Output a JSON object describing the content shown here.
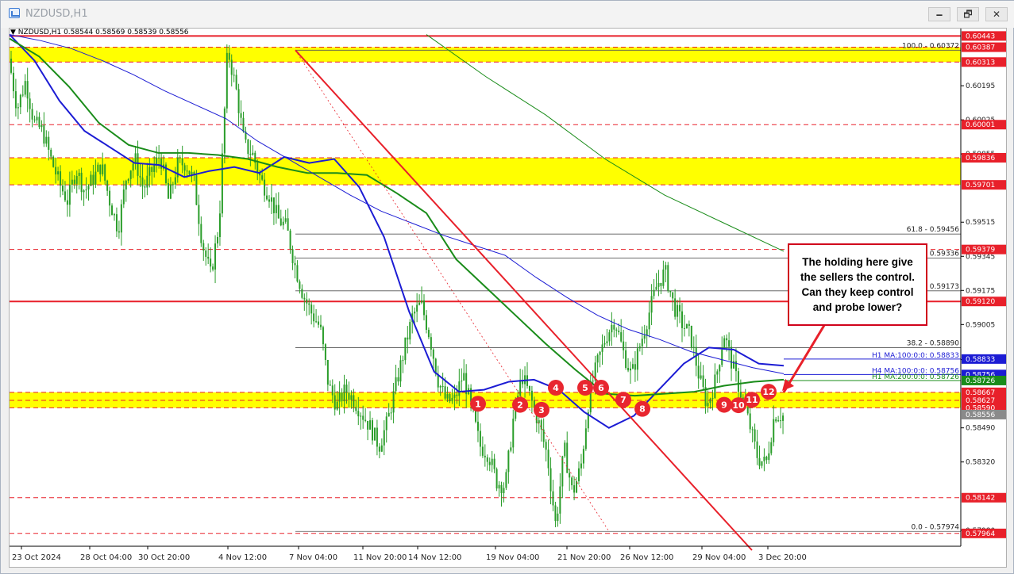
{
  "window": {
    "title": "NZDUSD,H1",
    "minimize_label": "🗕",
    "restore_label": "🗗",
    "close_label": "✕"
  },
  "symbol_line": "NZDUSD,H1  0.58544 0.58569 0.58539 0.58556",
  "callout_text": "The holding here give the sellers the control. Can they keep control and probe lower?",
  "colors": {
    "red": "#e8202a",
    "yellow": "#ffff00",
    "ma_blue": "#1c1cd4",
    "ma_green": "#1a8c1a",
    "candle": "#2a9d2a",
    "fib": "#555555",
    "marker": "#e8262f"
  },
  "chart_data": {
    "type": "candlestick",
    "symbol": "NZDUSD",
    "timeframe": "H1",
    "ohlc_last": {
      "open": 0.58544,
      "high": 0.58569,
      "low": 0.58539,
      "close": 0.58556
    },
    "ylim": [
      0.579,
      0.6048
    ],
    "x_ticks": [
      "23 Oct 2024",
      "28 Oct 04:00",
      "30 Oct 20:00",
      "4 Nov 12:00",
      "7 Nov 04:00",
      "11 Nov 20:00",
      "14 Nov 12:00",
      "19 Nov 04:00",
      "21 Nov 20:00",
      "26 Nov 12:00",
      "29 Nov 04:00",
      "3 Dec 20:00"
    ],
    "y_ticks": [
      "0.60195",
      "0.60025",
      "0.59855",
      "0.59515",
      "0.59345",
      "0.59175",
      "0.59005",
      "0.58830",
      "0.58490",
      "0.58320",
      "0.57980"
    ],
    "price_labels": [
      {
        "text": "0.60443",
        "value": 0.60443,
        "style": "red"
      },
      {
        "text": "0.60387",
        "value": 0.60387,
        "style": "red"
      },
      {
        "text": "0.60313",
        "value": 0.60313,
        "style": "red"
      },
      {
        "text": "0.60001",
        "value": 0.60001,
        "style": "red"
      },
      {
        "text": "0.59836",
        "value": 0.59836,
        "style": "red"
      },
      {
        "text": "0.59701",
        "value": 0.59701,
        "style": "red"
      },
      {
        "text": "0.59379",
        "value": 0.59379,
        "style": "red"
      },
      {
        "text": "0.59120",
        "value": 0.5912,
        "style": "red"
      },
      {
        "text": "0.58833",
        "value": 0.58833,
        "style": "blue"
      },
      {
        "text": "0.58756",
        "value": 0.58756,
        "style": "blue"
      },
      {
        "text": "0.58726",
        "value": 0.58726,
        "style": "green"
      },
      {
        "text": "0.58667",
        "value": 0.58667,
        "style": "red"
      },
      {
        "text": "0.58627",
        "value": 0.58627,
        "style": "red"
      },
      {
        "text": "0.58590",
        "value": 0.5859,
        "style": "red"
      },
      {
        "text": "0.58556",
        "value": 0.58556,
        "style": "gray"
      },
      {
        "text": "0.58142",
        "value": 0.58142,
        "style": "red"
      },
      {
        "text": "0.57964",
        "value": 0.57964,
        "style": "red"
      }
    ],
    "zones": [
      {
        "from": 0.60313,
        "to": 0.60387
      },
      {
        "from": 0.59701,
        "to": 0.59836
      },
      {
        "from": 0.5859,
        "to": 0.58667
      }
    ],
    "fib_levels": [
      {
        "label": "100.0 - 0.60372",
        "value": 0.60372
      },
      {
        "label": "61.8 - 0.59456",
        "value": 0.59456
      },
      {
        "label": "0.59336",
        "value": 0.59336
      },
      {
        "label": "0.59173",
        "value": 0.59173
      },
      {
        "label": "38.2 - 0.58890",
        "value": 0.5889
      },
      {
        "label": "0.0 - 0.57974",
        "value": 0.57974
      }
    ],
    "ma_labels": [
      {
        "text": "H1 MA:100:0:0: 0.58833",
        "value": 0.58833
      },
      {
        "text": "H4 MA:100:0:0: 0.58756",
        "value": 0.58756
      },
      {
        "text": "H1 MA:200:0:0: 0.58726",
        "value": 0.58726
      }
    ],
    "markers": [
      {
        "label": "1",
        "price": 0.5861
      },
      {
        "label": "2",
        "price": 0.58605
      },
      {
        "label": "3",
        "price": 0.5858
      },
      {
        "label": "4",
        "price": 0.5869
      },
      {
        "label": "5",
        "price": 0.5869
      },
      {
        "label": "6",
        "price": 0.5869
      },
      {
        "label": "7",
        "price": 0.5863
      },
      {
        "label": "8",
        "price": 0.58585
      },
      {
        "label": "9",
        "price": 0.58605
      },
      {
        "label": "10",
        "price": 0.58603
      },
      {
        "label": "11",
        "price": 0.5863
      },
      {
        "label": "12",
        "price": 0.5867
      }
    ],
    "series": [
      {
        "name": "H1 MA 100",
        "values": [
          0.6045,
          0.6032,
          0.6012,
          0.5997,
          0.5989,
          0.5981,
          0.598,
          0.5974,
          0.5977,
          0.5979,
          0.5976,
          0.5984,
          0.5981,
          0.5983,
          0.5969,
          0.5944,
          0.5907,
          0.5877,
          0.5867,
          0.5868,
          0.5872,
          0.5873,
          0.5868,
          0.5857,
          0.5849,
          0.5855,
          0.5868,
          0.5881,
          0.5889,
          0.5888,
          0.5881,
          0.588
        ]
      },
      {
        "name": "H1 MA 200",
        "values": [
          0.6043,
          0.6034,
          0.6019,
          0.6001,
          0.599,
          0.5986,
          0.5986,
          0.5985,
          0.5983,
          0.5979,
          0.5976,
          0.5976,
          0.5975,
          0.5966,
          0.5956,
          0.5933,
          0.5919,
          0.5905,
          0.5891,
          0.5878,
          0.5866,
          0.5865,
          0.5866,
          0.5867,
          0.587,
          0.5872,
          0.5873
        ]
      },
      {
        "name": "H4 MA 100",
        "values": [
          0.6045,
          0.6042,
          0.6038,
          0.6032,
          0.6025,
          0.6017,
          0.601,
          0.6003,
          0.5992,
          0.5983,
          0.5974,
          0.5965,
          0.5957,
          0.5951,
          0.5945,
          0.594,
          0.5935,
          0.5924,
          0.5914,
          0.5905,
          0.5898,
          0.5893,
          0.5887,
          0.5883,
          0.5879,
          0.5876
        ]
      },
      {
        "name": "Long MA",
        "values": [
          0.6045,
          0.6024,
          0.6005,
          0.5983,
          0.5965,
          0.5951,
          0.5937
        ]
      }
    ],
    "price_path": [
      0.6033,
      0.6008,
      0.6022,
      0.6001,
      0.5997,
      0.5983,
      0.5971,
      0.5962,
      0.5978,
      0.5967,
      0.5973,
      0.598,
      0.5962,
      0.5948,
      0.5975,
      0.5983,
      0.5968,
      0.5977,
      0.5985,
      0.5962,
      0.598,
      0.5981,
      0.5972,
      0.5941,
      0.5925,
      0.5951,
      0.6038,
      0.6018,
      0.599,
      0.5985,
      0.5972,
      0.5965,
      0.5953,
      0.5949,
      0.593,
      0.5915,
      0.5906,
      0.5899,
      0.587,
      0.586,
      0.5868,
      0.5863,
      0.5856,
      0.5849,
      0.584,
      0.5852,
      0.587,
      0.5888,
      0.5905,
      0.5911,
      0.5895,
      0.5873,
      0.5862,
      0.5863,
      0.5876,
      0.5858,
      0.584,
      0.5836,
      0.5822,
      0.582,
      0.5855,
      0.5875,
      0.5864,
      0.5851,
      0.5835,
      0.58,
      0.5839,
      0.5816,
      0.583,
      0.5866,
      0.5882,
      0.5895,
      0.5903,
      0.5887,
      0.5875,
      0.589,
      0.5905,
      0.592,
      0.5927,
      0.591,
      0.5901,
      0.5895,
      0.5875,
      0.586,
      0.5873,
      0.5896,
      0.588,
      0.5866,
      0.5851,
      0.5834,
      0.5831,
      0.5856,
      0.5855
    ]
  }
}
